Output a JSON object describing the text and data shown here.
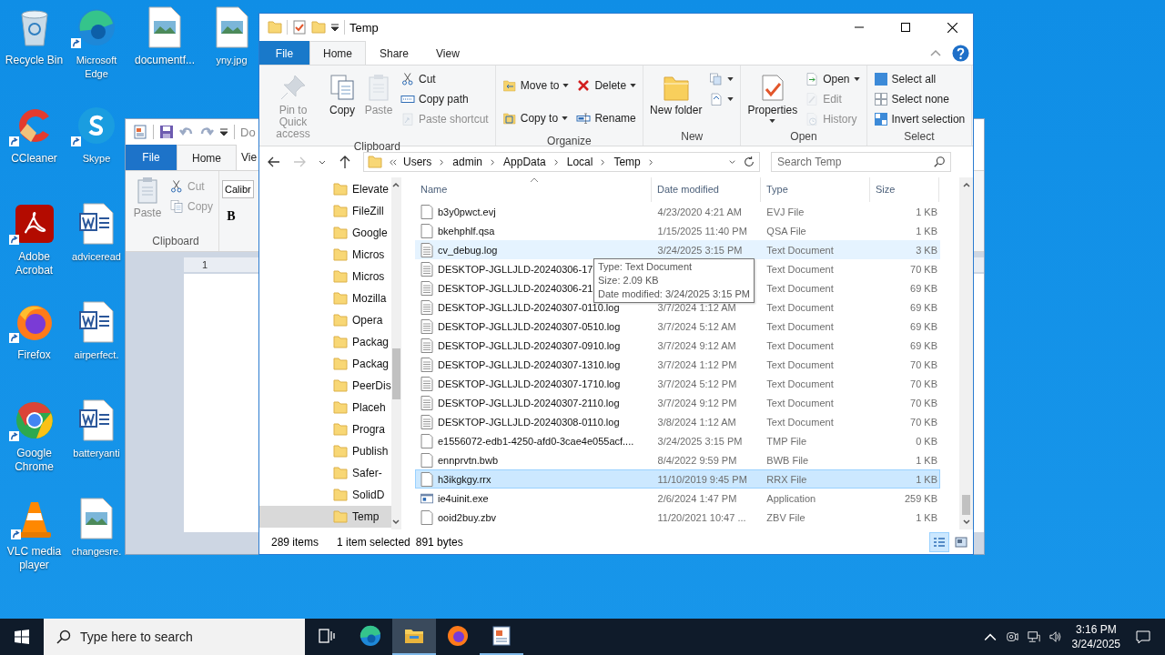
{
  "desktop": {
    "columns": [
      {
        "icons": [
          {
            "label": "Recycle Bin",
            "kind": "recycle",
            "shortcut": false
          },
          {
            "label": "CCleaner",
            "kind": "ccleaner",
            "shortcut": true
          },
          {
            "label": "Adobe Acrobat",
            "kind": "pdf",
            "shortcut": true
          },
          {
            "label": "Firefox",
            "kind": "firefox",
            "shortcut": true
          },
          {
            "label": "Google Chrome",
            "kind": "chrome",
            "shortcut": true
          },
          {
            "label": "VLC media player",
            "kind": "vlc",
            "shortcut": true
          }
        ]
      },
      {
        "icons": [
          {
            "label": "Microsoft Edge",
            "kind": "edge",
            "shortcut": true
          },
          {
            "label": "Skype",
            "kind": "skype",
            "shortcut": true
          },
          {
            "label": "adviceread",
            "kind": "word",
            "shortcut": false
          },
          {
            "label": "airperfect.",
            "kind": "word",
            "shortcut": false
          },
          {
            "label": "batteryanti",
            "kind": "word",
            "shortcut": false
          },
          {
            "label": "changesre.",
            "kind": "image",
            "shortcut": false
          }
        ]
      },
      {
        "icons": [
          {
            "label": "documentf...",
            "kind": "image",
            "shortcut": false
          }
        ]
      },
      {
        "icons": [
          {
            "label": "yny.jpg",
            "kind": "image",
            "shortcut": false
          }
        ]
      }
    ]
  },
  "word_window": {
    "title": "Do",
    "tabs": [
      {
        "label": "File",
        "selected": false
      },
      {
        "label": "Home",
        "selected": true
      },
      {
        "label": "Vie",
        "selected": false
      }
    ],
    "paste": "Paste",
    "cut": "Cut",
    "copy": "Copy",
    "group": "Clipboard",
    "font": "Calibr",
    "bold": "B",
    "ruler": "1"
  },
  "explorer": {
    "title": "Temp",
    "tabs": [
      {
        "label": "File",
        "kind": "file",
        "selected": false
      },
      {
        "label": "Home",
        "kind": "tab",
        "selected": true
      },
      {
        "label": "Share",
        "kind": "tab",
        "selected": false
      },
      {
        "label": "View",
        "kind": "tab",
        "selected": false
      }
    ],
    "ribbon": [
      {
        "label": "Clipboard",
        "columns": [
          [
            {
              "label": "Pin to Quick access",
              "kind": "large",
              "disabled": true
            }
          ],
          [
            {
              "label": "Copy",
              "kind": "large",
              "disabled": false
            }
          ],
          [
            {
              "label": "Paste",
              "kind": "large",
              "disabled": true
            }
          ],
          [
            {
              "label": "Cut",
              "kind": "small",
              "disabled": false
            },
            {
              "label": "Copy path",
              "kind": "small",
              "disabled": false
            },
            {
              "label": "Paste shortcut",
              "kind": "small",
              "disabled": true
            }
          ]
        ]
      },
      {
        "label": "Organize",
        "columns": [
          [
            {
              "label": "Move to",
              "kind": "small-menu",
              "disabled": false
            },
            {
              "label": "Copy to",
              "kind": "small-menu",
              "disabled": false
            }
          ],
          [
            {
              "label": "Delete",
              "kind": "small-menu",
              "disabled": false
            },
            {
              "label": "Rename",
              "kind": "small",
              "disabled": false
            }
          ]
        ]
      },
      {
        "label": "New",
        "columns": [
          [
            {
              "label": "New folder",
              "kind": "large",
              "disabled": false
            }
          ],
          [
            {
              "kind": "icon-menu",
              "disabled": false
            },
            {
              "kind": "icon-menu",
              "disabled": false
            }
          ]
        ]
      },
      {
        "label": "Open",
        "columns": [
          [
            {
              "label": "Properties",
              "kind": "large-menu",
              "disabled": false
            }
          ],
          [
            {
              "label": "Open",
              "kind": "small-menu",
              "disabled": false
            },
            {
              "label": "Edit",
              "kind": "small",
              "disabled": true
            },
            {
              "label": "History",
              "kind": "small",
              "disabled": true
            }
          ]
        ]
      },
      {
        "label": "Select",
        "columns": [
          [
            {
              "label": "Select all",
              "kind": "small",
              "disabled": false
            },
            {
              "label": "Select none",
              "kind": "small",
              "disabled": false
            },
            {
              "label": "Invert selection",
              "kind": "small",
              "disabled": false
            }
          ]
        ]
      }
    ],
    "path": [
      "Users",
      "admin",
      "AppData",
      "Local",
      "Temp"
    ],
    "search": {
      "placeholder": "Search Temp"
    },
    "nav": [
      {
        "label": "Elevate",
        "selected": false
      },
      {
        "label": "FileZill",
        "selected": false
      },
      {
        "label": "Google",
        "selected": false
      },
      {
        "label": "Micros",
        "selected": false
      },
      {
        "label": "Micros",
        "selected": false
      },
      {
        "label": "Mozilla",
        "selected": false
      },
      {
        "label": "Opera",
        "selected": false
      },
      {
        "label": "Packag",
        "selected": false
      },
      {
        "label": "Packag",
        "selected": false
      },
      {
        "label": "PeerDis",
        "selected": false
      },
      {
        "label": "Placeh",
        "selected": false
      },
      {
        "label": "Progra",
        "selected": false
      },
      {
        "label": "Publish",
        "selected": false
      },
      {
        "label": "Safer-",
        "selected": false
      },
      {
        "label": "SolidD",
        "selected": false
      },
      {
        "label": "Temp",
        "selected": true
      }
    ],
    "columns": [
      "Name",
      "Date modified",
      "Type",
      "Size"
    ],
    "rows": [
      {
        "name": "b3y0pwct.evj",
        "date": "4/23/2020 4:21 AM",
        "type": "EVJ File",
        "size": "1 KB",
        "kind": "blank",
        "selected": false,
        "hovered": false
      },
      {
        "name": "bkehphlf.qsa",
        "date": "1/15/2025 11:40 PM",
        "type": "QSA File",
        "size": "1 KB",
        "kind": "blank",
        "selected": false,
        "hovered": false
      },
      {
        "name": "cv_debug.log",
        "date": "3/24/2025 3:15 PM",
        "type": "Text Document",
        "size": "3 KB",
        "kind": "text",
        "selected": false,
        "hovered": true
      },
      {
        "name": "DESKTOP-JGLLJLD-20240306-17",
        "type": "Text Document",
        "size": "70 KB",
        "kind": "text",
        "selected": false,
        "hovered": false
      },
      {
        "name": "DESKTOP-JGLLJLD-20240306-21",
        "type": "Text Document",
        "size": "69 KB",
        "kind": "text",
        "selected": false,
        "hovered": false
      },
      {
        "name": "DESKTOP-JGLLJLD-20240307-0110.log",
        "date": "3/7/2024 1:12 AM",
        "type": "Text Document",
        "size": "69 KB",
        "kind": "text",
        "selected": false,
        "hovered": false
      },
      {
        "name": "DESKTOP-JGLLJLD-20240307-0510.log",
        "date": "3/7/2024 5:12 AM",
        "type": "Text Document",
        "size": "69 KB",
        "kind": "text",
        "selected": false,
        "hovered": false
      },
      {
        "name": "DESKTOP-JGLLJLD-20240307-0910.log",
        "date": "3/7/2024 9:12 AM",
        "type": "Text Document",
        "size": "69 KB",
        "kind": "text",
        "selected": false,
        "hovered": false
      },
      {
        "name": "DESKTOP-JGLLJLD-20240307-1310.log",
        "date": "3/7/2024 1:12 PM",
        "type": "Text Document",
        "size": "70 KB",
        "kind": "text",
        "selected": false,
        "hovered": false
      },
      {
        "name": "DESKTOP-JGLLJLD-20240307-1710.log",
        "date": "3/7/2024 5:12 PM",
        "type": "Text Document",
        "size": "70 KB",
        "kind": "text",
        "selected": false,
        "hovered": false
      },
      {
        "name": "DESKTOP-JGLLJLD-20240307-2110.log",
        "date": "3/7/2024 9:12 PM",
        "type": "Text Document",
        "size": "70 KB",
        "kind": "text",
        "selected": false,
        "hovered": false
      },
      {
        "name": "DESKTOP-JGLLJLD-20240308-0110.log",
        "date": "3/8/2024 1:12 AM",
        "type": "Text Document",
        "size": "70 KB",
        "kind": "text",
        "selected": false,
        "hovered": false
      },
      {
        "name": "e1556072-edb1-4250-afd0-3cae4e055acf....",
        "date": "3/24/2025 3:15 PM",
        "type": "TMP File",
        "size": "0 KB",
        "kind": "blank",
        "selected": false,
        "hovered": false
      },
      {
        "name": "ennprvtn.bwb",
        "date": "8/4/2022 9:59 PM",
        "type": "BWB File",
        "size": "1 KB",
        "kind": "blank",
        "selected": false,
        "hovered": false
      },
      {
        "name": "h3ikgkgy.rrx",
        "date": "11/10/2019 9:45 PM",
        "type": "RRX File",
        "size": "1 KB",
        "kind": "blank",
        "selected": true,
        "hovered": false
      },
      {
        "name": "ie4uinit.exe",
        "date": "2/6/2024 1:47 PM",
        "type": "Application",
        "size": "259 KB",
        "kind": "app",
        "selected": false,
        "hovered": false
      },
      {
        "name": "ooid2buy.zbv",
        "date": "11/20/2021 10:47 ...",
        "type": "ZBV File",
        "size": "1 KB",
        "kind": "blank",
        "selected": false,
        "hovered": false
      }
    ],
    "tooltip": [
      "Type: Text Document",
      "Size: 2.09 KB",
      "Date modified: 3/24/2025 3:15 PM"
    ],
    "status": {
      "count": "289 items",
      "selection": "1 item selected",
      "bytes": "891 bytes"
    },
    "views": [
      {
        "kind": "details",
        "selected": true
      },
      {
        "kind": "large",
        "selected": false
      }
    ]
  },
  "taskbar": {
    "search": {
      "placeholder": "Type here to search"
    },
    "apps": [
      {
        "kind": "edge",
        "selected": false,
        "running": false
      },
      {
        "kind": "explorer",
        "selected": true,
        "running": true
      },
      {
        "kind": "firefox",
        "selected": false,
        "running": false
      },
      {
        "kind": "wordpad",
        "selected": false,
        "running": true
      }
    ],
    "time": "3:16 PM",
    "date": "3/24/2025"
  }
}
